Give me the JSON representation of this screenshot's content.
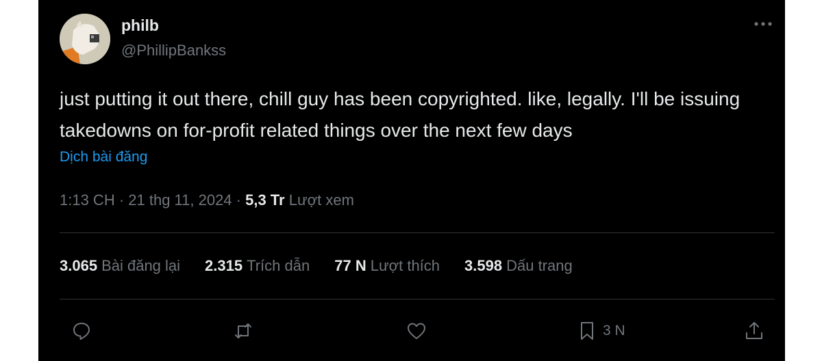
{
  "author": {
    "display_name": "philb",
    "handle": "@PhillipBankss"
  },
  "tweet": {
    "text": "just putting it out there, chill guy has been copyrighted. like, legally. I'll be issuing takedowns on for-profit related things over the next few days",
    "translate_label": "Dịch bài đăng",
    "timestamp": "1:13 CH · 21 thg 11, 2024",
    "separator": " · ",
    "views_count": "5,3 Tr",
    "views_label": "Lượt xem"
  },
  "stats": {
    "reposts_count": "3.065",
    "reposts_label": "Bài đăng lại",
    "quotes_count": "2.315",
    "quotes_label": "Trích dẫn",
    "likes_count": "77 N",
    "likes_label": "Lượt thích",
    "bookmarks_count": "3.598",
    "bookmarks_label": "Dấu trang"
  },
  "actions": {
    "bookmark_count": "3 N"
  },
  "icons": {
    "more": "more-horizontal-icon",
    "reply": "reply-icon",
    "repost": "repost-icon",
    "like": "heart-icon",
    "bookmark": "bookmark-icon",
    "share": "share-icon"
  },
  "colors": {
    "background": "#000000",
    "text": "#e7e9ea",
    "muted": "#71767b",
    "link": "#1d9bf0",
    "divider": "#2f3336"
  }
}
